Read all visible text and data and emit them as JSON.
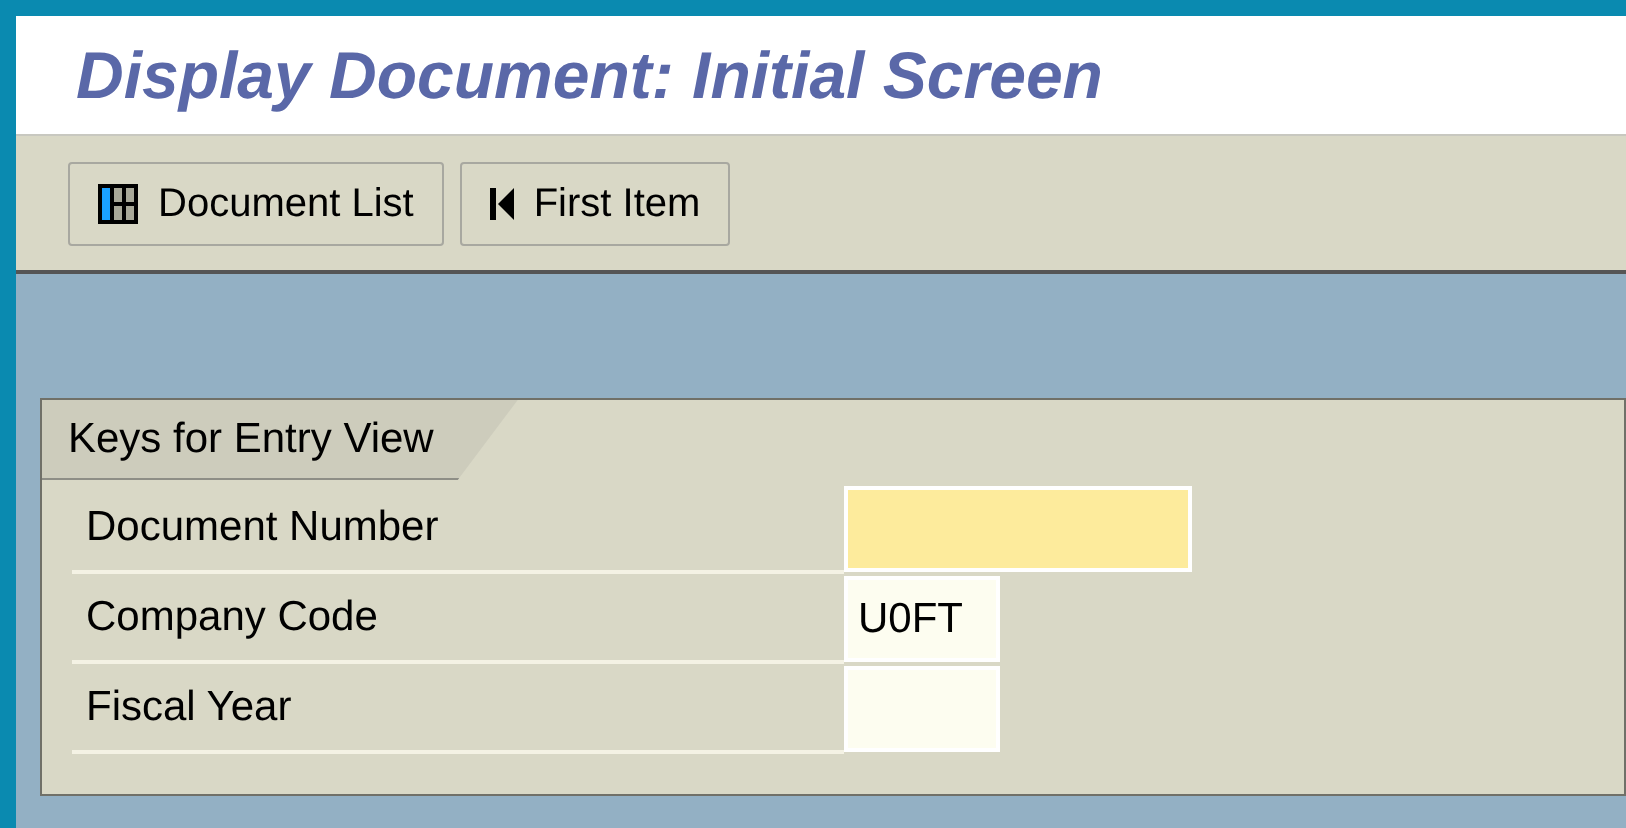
{
  "window": {
    "title": "Display Document: Initial Screen"
  },
  "toolbar": [
    {
      "kind": "list",
      "label": "Document List"
    },
    {
      "kind": "first",
      "label": "First Item"
    }
  ],
  "group": {
    "title": "Keys for Entry View",
    "fields": [
      {
        "label": "Document Number",
        "required": true
      },
      {
        "label": "Company Code",
        "value": "U0FT",
        "required": false
      },
      {
        "label": "Fiscal Year",
        "required": false
      }
    ]
  }
}
